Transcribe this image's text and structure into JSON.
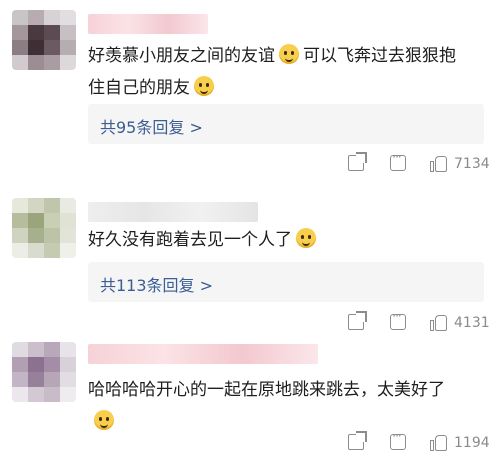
{
  "comments": [
    {
      "text_lines": [
        "好羡慕小朋友之间的友谊",
        "可以飞奔过去狠狠抱",
        "住自己的朋友"
      ],
      "replies_label": "共95条回复 >",
      "likes": "7134",
      "emoji_icons": [
        "smiling-face-icon",
        "smiling-face-icon"
      ]
    },
    {
      "text": "好久没有跑着去见一个人了",
      "replies_label": "共113条回复 >",
      "likes": "4131",
      "emoji_icons": [
        "blushing-face-icon"
      ]
    },
    {
      "text": "哈哈哈哈开心的一起在原地跳来跳去，太美好了",
      "likes": "1194",
      "emoji_icons": [
        "happy-face-icon"
      ]
    }
  ],
  "colors": {
    "link": "#3a5d93",
    "text": "#1e1e1e",
    "muted": "#8a8a8a",
    "reply_bg": "#f5f5f5"
  }
}
